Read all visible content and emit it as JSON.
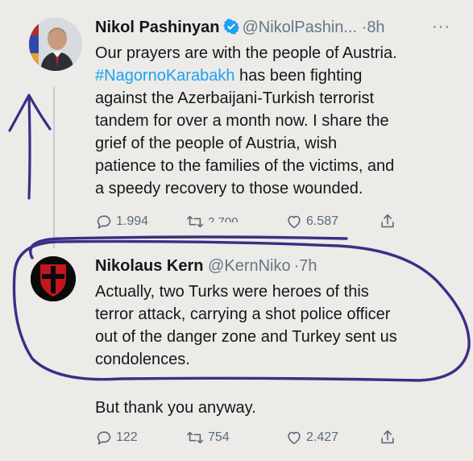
{
  "tweet1": {
    "name": "Nikol Pashinyan",
    "handle": "@NikolPashin...",
    "dot": "·",
    "time": "8h",
    "more": "···",
    "text_before": "Our prayers are with the people of Austria.",
    "hashtag": "#NagornoKarabakh",
    "text_after": " has been fighting\nagainst the Azerbaijani-Turkish terrorist\ntandem for over a month now. I share the\ngrief of the people of Austria, wish\npatience to the families of the victims, and\na speedy recovery to those wounded.",
    "replies": "1.994",
    "retweets": "2.700",
    "likes": "6.587"
  },
  "tweet2": {
    "name": "Nikolaus Kern",
    "handle": "@KernNiko",
    "dot": "·",
    "time": "7h",
    "text": "Actually, two Turks were heroes of this\nterror attack, carrying a shot police officer\nout of the danger zone and Turkey sent us\ncondolences.",
    "text2": "But thank you anyway.",
    "replies": "122",
    "retweets": "754",
    "likes": "2.427"
  },
  "colors": {
    "hashtag": "#1da1f2",
    "verified": "#1da1f2",
    "annotation": "#3a2f86"
  },
  "icons": [
    "reply-icon",
    "retweet-icon",
    "like-icon",
    "share-icon",
    "verified-badge-icon",
    "more-icon"
  ]
}
